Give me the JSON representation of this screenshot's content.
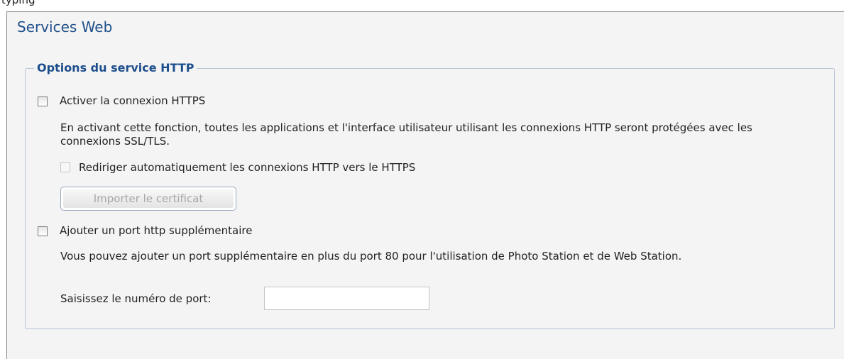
{
  "top_strip_text": "typing",
  "panel": {
    "title": "Services Web",
    "section_title": "Options du service HTTP"
  },
  "https": {
    "label": "Activer la connexion HTTPS",
    "description": "En activant cette fonction, toutes les applications et l'interface utilisateur utilisant les connexions HTTP seront protégées avec les connexions SSL/TLS.",
    "redirect_label": "Rediriger automatiquement les connexions HTTP vers le HTTPS",
    "import_button": "Importer le certificat"
  },
  "extra_port": {
    "label": "Ajouter un port http supplémentaire",
    "description": "Vous pouvez ajouter un port supplémentaire en plus du port 80 pour l'utilisation de Photo Station et de Web Station.",
    "port_label": "Saisissez le numéro de port:",
    "port_value": ""
  }
}
